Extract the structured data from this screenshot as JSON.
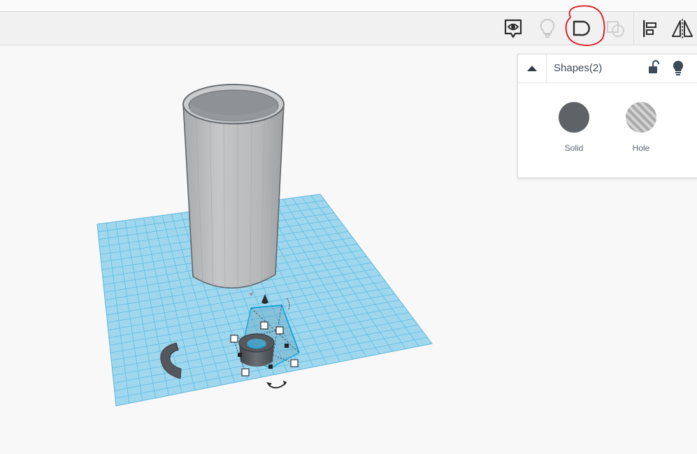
{
  "toolbar": {
    "buttons": [
      {
        "name": "show-notes",
        "icon": "eye-bubble-icon",
        "active": true
      },
      {
        "name": "show-all",
        "icon": "lightbulb-icon",
        "active": false
      },
      {
        "name": "group",
        "icon": "group-icon",
        "active": true,
        "highlighted": true
      },
      {
        "name": "ungroup",
        "icon": "ungroup-icon",
        "active": false
      },
      {
        "name": "align",
        "icon": "align-icon",
        "active": true
      },
      {
        "name": "mirror",
        "icon": "mirror-icon",
        "active": true
      }
    ]
  },
  "inspector": {
    "title": "Shapes(2)",
    "options": [
      {
        "label": "Solid",
        "icon": "solid-swatch"
      },
      {
        "label": "Hole",
        "icon": "hole-swatch"
      }
    ]
  },
  "colors": {
    "workplane": "#9fd7ee",
    "grid_line": "#56b7de",
    "solid_shape": "#5f6367",
    "tube": "#b9bbbd",
    "selection": "#1aa6d8",
    "annotation": "#d9121a"
  },
  "annotations": [
    {
      "shape": "red-circle",
      "target": "group-button"
    }
  ]
}
